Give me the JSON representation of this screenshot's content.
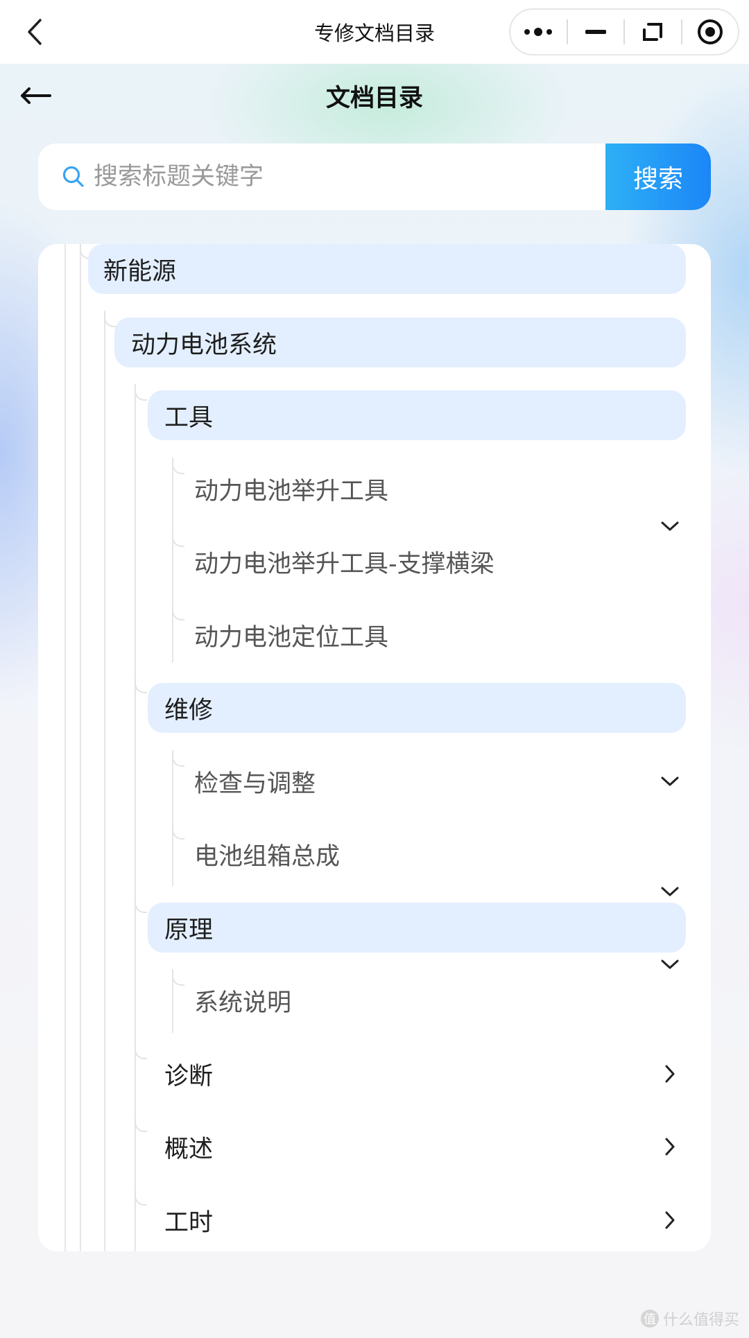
{
  "topbar": {
    "title": "专修文档目录"
  },
  "page": {
    "title": "文档目录"
  },
  "search": {
    "placeholder": "搜索标题关键字",
    "button_label": "搜索"
  },
  "tree": {
    "level1": "新能源",
    "level2": "动力电池系统",
    "groups": {
      "tools": {
        "label": "工具",
        "items": [
          "动力电池举升工具",
          "动力电池举升工具-支撑横梁",
          "动力电池定位工具"
        ]
      },
      "repair": {
        "label": "维修",
        "items": [
          "检查与调整",
          "电池组箱总成"
        ]
      },
      "principle": {
        "label": "原理",
        "items": [
          "系统说明"
        ]
      },
      "diagnosis": {
        "label": "诊断"
      },
      "overview": {
        "label": "概述"
      },
      "labor": {
        "label": "工时"
      }
    }
  },
  "watermark": {
    "text": "什么值得买",
    "badge": "值"
  },
  "colors": {
    "accent": "#1c86f7",
    "highlight": "#e3efff"
  }
}
